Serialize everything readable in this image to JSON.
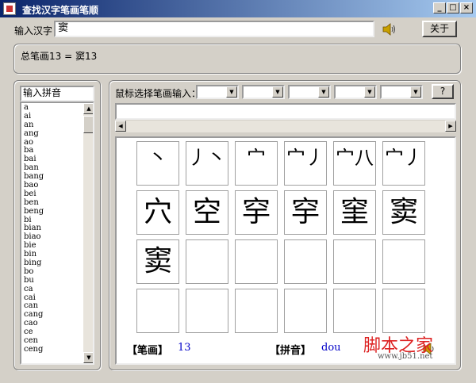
{
  "window": {
    "title": "查找汉字笔画笔顺"
  },
  "input": {
    "label": "输入汉字",
    "value": "窦",
    "about_label": "关于"
  },
  "result": {
    "text": "总笔画13 = 窦13"
  },
  "pinyin": {
    "header": "输入拼音",
    "items": [
      "a",
      "ai",
      "an",
      "ang",
      "ao",
      "ba",
      "bai",
      "ban",
      "bang",
      "bao",
      "bei",
      "ben",
      "beng",
      "bi",
      "bian",
      "biao",
      "bie",
      "bin",
      "bing",
      "bo",
      "bu",
      "ca",
      "cai",
      "can",
      "cang",
      "cao",
      "ce",
      "cen",
      "ceng"
    ]
  },
  "stroke_select": {
    "label": "鼠标选择笔画输入：",
    "help_label": "?"
  },
  "strokes": [
    "丶",
    "丿丶",
    "宀",
    "宀丿",
    "宀八",
    "宀丿",
    "穴",
    "空",
    "穻",
    "穻",
    "窐",
    "窦",
    "窦"
  ],
  "footer": {
    "stroke_label": "【笔画】",
    "stroke_count": "13",
    "pinyin_label": "【拼音】",
    "pinyin_value": "dou"
  },
  "watermark": {
    "main": "脚本之家",
    "sub": "www.jb51.net"
  },
  "icons": {
    "speaker": "speaker-icon",
    "app": "app-icon"
  }
}
